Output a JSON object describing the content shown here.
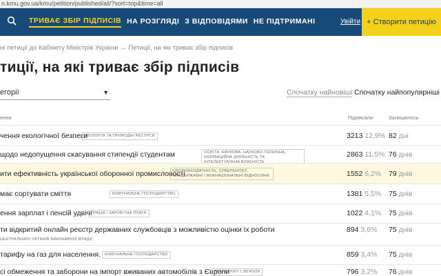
{
  "browser": {
    "url": "n.kmu.gov.ua/kmu/petition/published/all/?sort=top&time=all"
  },
  "nav": {
    "tabs": [
      {
        "label": "ТРИВАЄ ЗБІР ПІДПИСІВ",
        "active": true
      },
      {
        "label": "НА РОЗГЛЯДІ",
        "active": false
      },
      {
        "label": "З ВІДПОВІДЯМИ",
        "active": false
      },
      {
        "label": "НЕ ПІДТРИМАНІ",
        "active": false
      }
    ],
    "login": "Увійти",
    "create": "+ Створити петицію",
    "search_icon": "search-icon",
    "colors": {
      "bar": "#184a78",
      "accent": "#f5d21a"
    }
  },
  "breadcrumb": {
    "root": "ні петиції до Кабінету Міністрів України",
    "sep": "→",
    "current": "Петиції, на які триває збір підписів"
  },
  "page": {
    "title": "тиції, на які триває збір підписів",
    "category_value": "егорії",
    "sort_newest": "Спочатку найновіші",
    "sort_popular": "Спочатку найпопулярніші"
  },
  "table": {
    "headers": {
      "name": "ення",
      "signatures": "Підписали",
      "remaining": "Залишилось"
    },
    "days_unit": "днів",
    "rows": [
      {
        "title": "чення екологічної безпеки",
        "tag": "ЕКОЛОГІЯ ТА ПРИРОДНІ РЕСУРСИ",
        "signs": "3213",
        "pct": "12,9%",
        "days": "82",
        "unit": "дні",
        "highlight": false
      },
      {
        "title": "щодо недопущення скасування стипендії студентам",
        "tag": "ОСВІТА, НАУКОВА, НАУКОВО-ТЕХНІЧНА, ІННОВАЦІЙНА ДІЯЛЬНІСТЬ ТА ІНТЕЛЕКТУАЛЬНА ВЛАСНІСТЬ",
        "signs": "2863",
        "pct": "11,5%",
        "days": "76",
        "unit": "днів",
        "highlight": false
      },
      {
        "title": "ити ефективність української оборонної промисловості",
        "tag": "ОБОРОНОЗДАТНІСТЬ, СУВЕРЕНІТЕТ, МІЖДЕРЖАВНІ І МІЖНАЦІОНАЛЬНІ ВІДНОСИНИ",
        "signs": "1552",
        "pct": "6,2%",
        "days": "79",
        "unit": "днів",
        "highlight": true
      },
      {
        "title": "має сортувати сміття",
        "tag": "КОМУНАЛЬНЕ ГОСПОДАРСТВО",
        "signs": "1381",
        "pct": "5,5%",
        "days": "75",
        "unit": "днів",
        "highlight": false
      },
      {
        "title": "ення зарплат і пенсій удвічі",
        "tag": "ПРАЦЯ І ЗАРОБІТНА ПЛАТА",
        "signs": "1022",
        "pct": "4,1%",
        "days": "75",
        "unit": "днів",
        "highlight": false
      },
      {
        "title": "ти відкритий онлайн реєстр державних службовців з можливістю оцінки їх роботи",
        "tag": "ЦЕНТРАЛЬНИХ ОРГАНІВ ВИКОНАВЧОЇ ВЛАДИ",
        "signs": "894",
        "pct": "3,6%",
        "days": "75",
        "unit": "днів",
        "highlight": false
      },
      {
        "title": "тарифу на газ для населення.",
        "tag": "КОМУНАЛЬНЕ ГОСПОДАРСТВО",
        "signs": "859",
        "pct": "3,4%",
        "days": "75",
        "unit": "днів",
        "highlight": false
      },
      {
        "title": "сі обмеження та заборони на імпорт вживаних автомобілів з Європи",
        "tag": "ТРАНСПОРТ І ЗВ'ЯЗОК",
        "signs": "796",
        "pct": "3,2%",
        "days": "76",
        "unit": "днів",
        "highlight": false
      }
    ]
  }
}
